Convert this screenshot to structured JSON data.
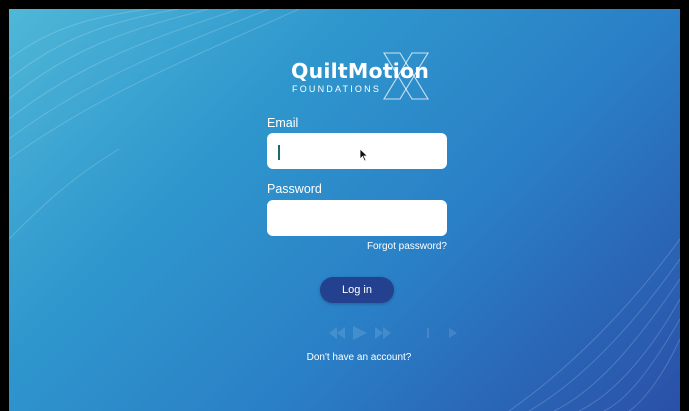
{
  "logo": {
    "brand": "QuiltMotion",
    "subtitle": "FOUNDATIONS",
    "mark": "X"
  },
  "login_form": {
    "email_label": "Email",
    "email_value": "",
    "password_label": "Password",
    "password_value": "",
    "forgot_password": "Forgot password?",
    "login_button": "Log in",
    "signup_prompt": "Don't have an account?"
  },
  "colors": {
    "background_start": "#4fb7d7",
    "background_end": "#2a50a8",
    "button": "#23418f",
    "text": "#ffffff"
  },
  "icons": {
    "cursor": "mouse-pointer-icon",
    "media_controls": "media-controls-icon"
  }
}
